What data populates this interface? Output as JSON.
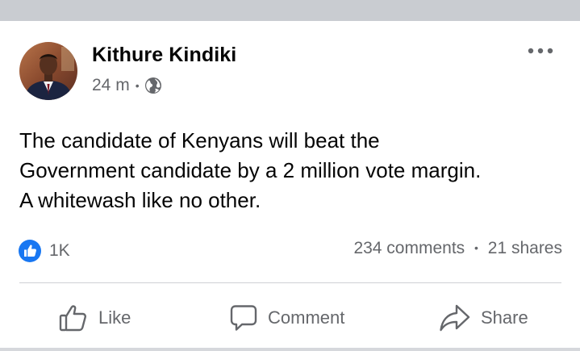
{
  "post": {
    "author": "Kithure Kindiki",
    "time": "24 m",
    "visibility_icon": "globe-icon",
    "text_lines": [
      "The candidate of Kenyans will beat the",
      "Government candidate by a 2 million vote margin.",
      "A whitewash like no other."
    ]
  },
  "engagement": {
    "reaction_icon": "like-badge-icon",
    "reactions_count": "1K",
    "comments": "234 comments",
    "separator": "•",
    "shares": "21 shares"
  },
  "actions": {
    "like": "Like",
    "comment": "Comment",
    "share": "Share"
  },
  "colors": {
    "text": "#050505",
    "secondary": "#65676b",
    "like_blue": "#1877f2",
    "divider": "#ced0d4",
    "top_strip": "#c9ccd1"
  }
}
